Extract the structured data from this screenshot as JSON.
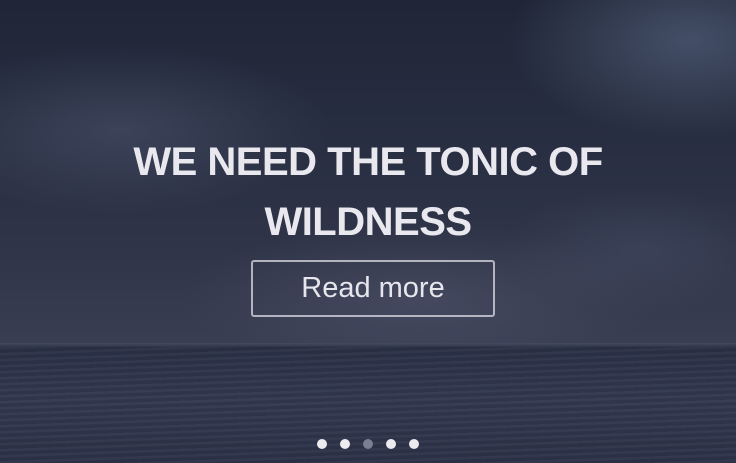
{
  "hero": {
    "headline": "WE NEED THE TONIC OF WILDNESS",
    "button_label": "Read more"
  },
  "carousel": {
    "slide_count": 5,
    "active_index": 2
  },
  "colors": {
    "text": "#e8e8ee",
    "dot": "#ececf0",
    "dot_active": "#7a7f93",
    "background": "#242a3c"
  }
}
